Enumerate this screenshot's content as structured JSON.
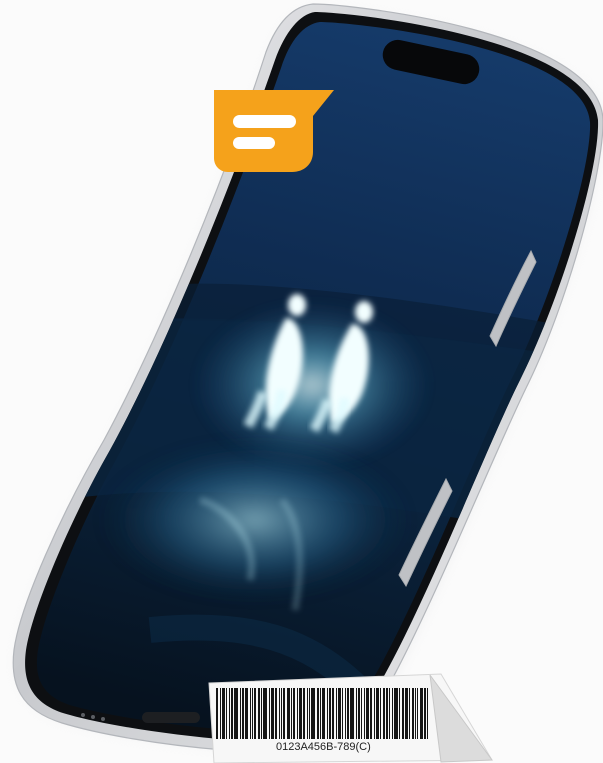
{
  "scene": {
    "subject": "phone-mockup",
    "colors": {
      "background": "#fbfbfb",
      "frame": "#d8d9dc",
      "bezel": "#0d0f12",
      "screen_top": "#0f2f57",
      "screen_bottom": "#061526",
      "glow": "#bff7ff",
      "badge": "#f5a21b"
    }
  },
  "badge": {
    "icon": "message-lines-icon"
  },
  "barcode": {
    "code": "0123A456B-789(C)"
  }
}
